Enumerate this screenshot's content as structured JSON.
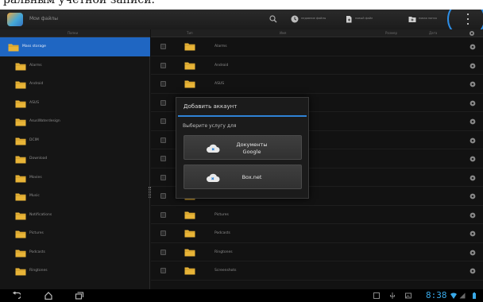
{
  "page": {
    "top_text": "ральным учетной записи."
  },
  "app": {
    "title": "Мои файлы"
  },
  "actionbar": {
    "search_label": "",
    "new_action_1": "недавние файлы",
    "new_action_2": "новый файл",
    "new_action_3": "новая папка"
  },
  "columns": {
    "left_header": "Папки",
    "type": "Тип",
    "name": "Имя",
    "size": "Размер",
    "date": "Дата"
  },
  "left_items": [
    "Mass storage",
    "Alarms",
    "Android",
    "ASUS",
    "AsusWaterdesign",
    "DCIM",
    "Download",
    "Movies",
    "Music",
    "Notifications",
    "Pictures",
    "Podcasts",
    "Ringtones"
  ],
  "right_rows": [
    "Alarms",
    "Android",
    "ASUS",
    "",
    "",
    "",
    "",
    "",
    "Notifications",
    "Pictures",
    "Podcasts",
    "Ringtones",
    "Screenshots"
  ],
  "dialog": {
    "title": "Добавить аккаунт",
    "subtitle": "Выберите услугу для",
    "option_google_line1": "Документы",
    "option_google_line2": "Google",
    "option_box": "Box.net"
  },
  "statusbar": {
    "clock": "8:38"
  },
  "colors": {
    "accent_blue": "#2f82d6",
    "selection_blue": "#1f66c2",
    "folder_yellow": "#e8b437",
    "clock_blue": "#39a9e8",
    "circle_blue": "#2d8ee6"
  },
  "icons": {
    "actionbar": [
      "search-icon",
      "recent-icon",
      "new-file-icon",
      "new-folder-icon",
      "overflow-menu-icon"
    ],
    "nav": [
      "back-icon",
      "home-icon",
      "recent-apps-icon"
    ]
  }
}
